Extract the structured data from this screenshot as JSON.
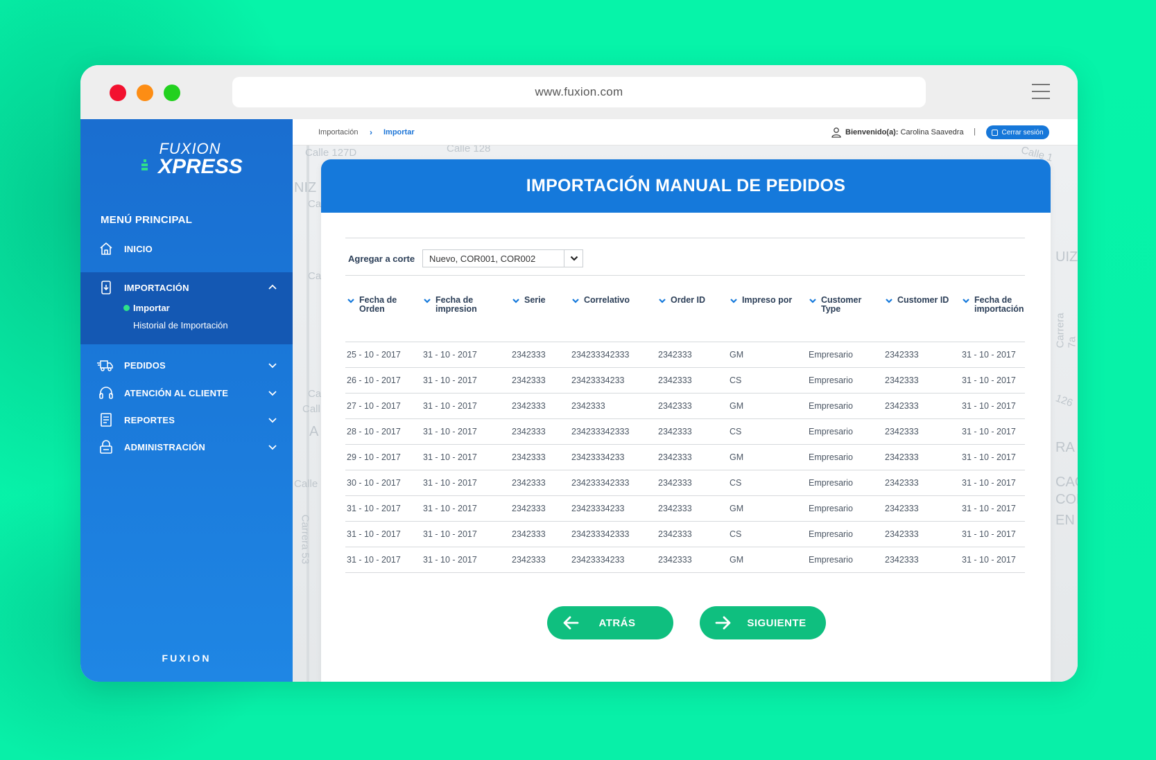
{
  "browser": {
    "url": "www.fuxion.com",
    "traffic_lights": {
      "red": "#f2112f",
      "orange": "#fd8d14",
      "green": "#22d11f"
    }
  },
  "sidebar": {
    "logo_top": "FUXION",
    "logo_bottom": "XPRESS",
    "menu_title": "MENÚ PRINCIPAL",
    "items": [
      {
        "label": "INICIO",
        "icon": "home-icon"
      },
      {
        "label": "IMPORTACIÓN",
        "icon": "phone-import-icon",
        "expanded": true,
        "children": [
          {
            "label": "Importar",
            "active": true
          },
          {
            "label": "Historial de Importación"
          }
        ]
      },
      {
        "label": "PEDIDOS",
        "icon": "truck-icon"
      },
      {
        "label": "ATENCIÓN AL CLIENTE",
        "icon": "headset-icon"
      },
      {
        "label": "REPORTES",
        "icon": "document-icon"
      },
      {
        "label": "ADMINISTRACIÓN",
        "icon": "lock-icon"
      }
    ],
    "footer_brand": "FUXION",
    "colors": {
      "background": "#1a6ed0",
      "active_group": "#1458b3",
      "active_dot": "#2ee388"
    }
  },
  "topbar": {
    "breadcrumb": [
      "Importación",
      "Importar"
    ],
    "welcome_label": "Bienvenido(a):",
    "user_name": "Carolina Saavedra",
    "separator": "|",
    "logout_label": "Cerrar sesión"
  },
  "map_labels": [
    "Calle 127D",
    "Calle 128",
    "Calle 1",
    "NIZ",
    "Ca",
    "Ca",
    "Ca",
    "Call",
    "A",
    "Calle",
    "Carrera 53",
    "UIZ",
    "Carrera 7a",
    "126",
    "RA",
    "CAG",
    "COR",
    "EN"
  ],
  "panel": {
    "title": "IMPORTACIÓN MANUAL DE PEDIDOS",
    "corte_label": "Agregar a corte",
    "corte_value": "Nuevo, COR001, COR002",
    "columns": [
      "Fecha de Orden",
      "Fecha de impresion",
      "Serie",
      "Correlativo",
      "Order ID",
      "Impreso por",
      "Customer Type",
      "Customer ID",
      "Fecha de importación"
    ],
    "rows": [
      [
        "25 - 10 - 2017",
        "31 - 10 - 2017",
        "2342333",
        "234233342333",
        "2342333",
        "GM",
        "Empresario",
        "2342333",
        "31 - 10 - 2017"
      ],
      [
        "26 - 10 - 2017",
        "31 - 10 - 2017",
        "2342333",
        "23423334233",
        "2342333",
        "CS",
        "Empresario",
        "2342333",
        "31 - 10 - 2017"
      ],
      [
        "27 - 10 - 2017",
        "31 - 10 - 2017",
        "2342333",
        "2342333",
        "2342333",
        "GM",
        "Empresario",
        "2342333",
        "31 - 10 - 2017"
      ],
      [
        "28 - 10 - 2017",
        "31 - 10 - 2017",
        "2342333",
        "234233342333",
        "2342333",
        "CS",
        "Empresario",
        "2342333",
        "31 - 10 - 2017"
      ],
      [
        "29 - 10 - 2017",
        "31 - 10 - 2017",
        "2342333",
        "23423334233",
        "2342333",
        "GM",
        "Empresario",
        "2342333",
        "31 - 10 - 2017"
      ],
      [
        "30 - 10 - 2017",
        "31 - 10 - 2017",
        "2342333",
        "234233342333",
        "2342333",
        "CS",
        "Empresario",
        "2342333",
        "31 - 10 - 2017"
      ],
      [
        "31 - 10 - 2017",
        "31 - 10 - 2017",
        "2342333",
        "23423334233",
        "2342333",
        "GM",
        "Empresario",
        "2342333",
        "31 - 10 - 2017"
      ],
      [
        "31 - 10 - 2017",
        "31 - 10 - 2017",
        "2342333",
        "234233342333",
        "2342333",
        "CS",
        "Empresario",
        "2342333",
        "31 - 10 - 2017"
      ],
      [
        "31 - 10 - 2017",
        "31 - 10 - 2017",
        "2342333",
        "23423334233",
        "2342333",
        "GM",
        "Empresario",
        "2342333",
        "31 - 10 - 2017"
      ]
    ],
    "back_label": "ATRÁS",
    "next_label": "SIGUIENTE",
    "colors": {
      "header": "#1579db",
      "buttons": "#0fbf7f"
    }
  }
}
